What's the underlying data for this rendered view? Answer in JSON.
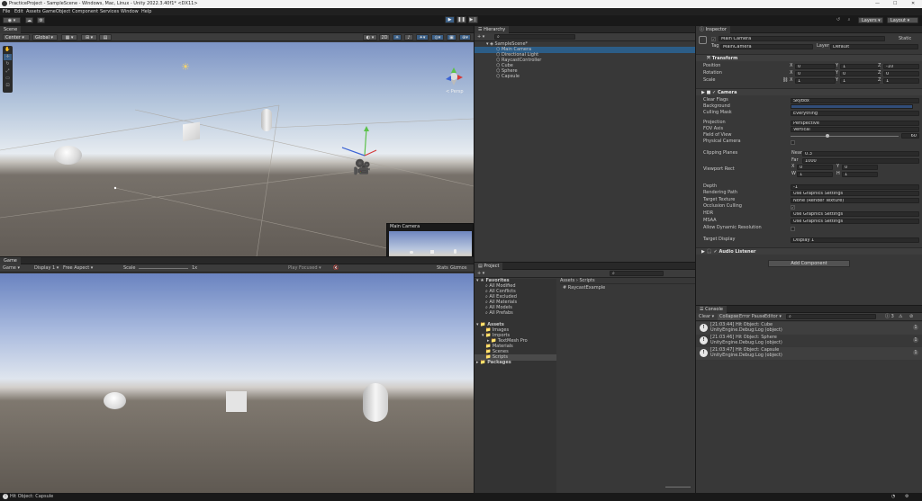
{
  "window": {
    "title": "PracticeProject - SampleScene - Windows, Mac, Linux - Unity 2022.3.40f1* <DX11>"
  },
  "menu": [
    "File",
    "Edit",
    "Assets",
    "GameObject",
    "Component",
    "Services",
    "Window",
    "Help"
  ],
  "toolbar": {
    "layers": "Layers",
    "layout": "Layout"
  },
  "scene": {
    "tab": "Scene",
    "center": "Center",
    "global": "Global",
    "persp": "< Persp",
    "preview_title": "Main Camera"
  },
  "game": {
    "tab": "Game",
    "mode": "Game",
    "display": "Display 1",
    "aspect": "Free Aspect",
    "scale_label": "Scale",
    "scale_value": "1x",
    "play_focused": "Play Focused",
    "stats": "Stats",
    "gizmos": "Gizmos"
  },
  "hierarchy": {
    "tab": "Hierarchy",
    "scene": "SampleScene*",
    "items": [
      "Main Camera",
      "Directional Light",
      "RaycastController",
      "Cube",
      "Sphere",
      "Capsule"
    ]
  },
  "project": {
    "tab": "Project",
    "favorites": "Favorites",
    "fav_items": [
      "All Modified",
      "All Conflicts",
      "All Excluded",
      "All Materials",
      "All Models",
      "All Prefabs"
    ],
    "assets": "Assets",
    "asset_items": [
      "Images",
      "Imports",
      "TextMesh Pro",
      "Materials",
      "Scenes",
      "Scripts"
    ],
    "packages": "Packages",
    "breadcrumb": [
      "Assets",
      "Scripts"
    ],
    "files": [
      "RaycastExample"
    ]
  },
  "inspector": {
    "tab": "Inspector",
    "object_name": "Main Camera",
    "static": "Static",
    "tag_label": "Tag",
    "tag": "MainCamera",
    "layer_label": "Layer",
    "layer": "Default",
    "transform": {
      "title": "Transform",
      "rows": [
        {
          "label": "Position",
          "x": "0",
          "y": "1",
          "z": "-10"
        },
        {
          "label": "Rotation",
          "x": "0",
          "y": "0",
          "z": "0"
        },
        {
          "label": "Scale",
          "x": "1",
          "y": "1",
          "z": "1"
        }
      ]
    },
    "camera": {
      "title": "Camera",
      "clear_flags_label": "Clear Flags",
      "clear_flags": "Skybox",
      "background_label": "Background",
      "culling_label": "Culling Mask",
      "culling": "Everything",
      "projection_label": "Projection",
      "projection": "Perspective",
      "fov_axis_label": "FOV Axis",
      "fov_axis": "Vertical",
      "fov_label": "Field of View",
      "fov": "60",
      "fov_fraction": 0.34,
      "physical_label": "Physical Camera",
      "clipping_label": "Clipping Planes",
      "near_label": "Near",
      "near": "0.3",
      "far_label": "Far",
      "far": "1000",
      "viewport_label": "Viewport Rect",
      "vx": "0",
      "vy": "0",
      "vw": "1",
      "vh": "1",
      "depth_label": "Depth",
      "depth": "-1",
      "rendering_label": "Rendering Path",
      "rendering": "Use Graphics Settings",
      "target_label": "Target Texture",
      "target": "None (Render Texture)",
      "occlusion_label": "Occlusion Culling",
      "hdr_label": "HDR",
      "hdr": "Use Graphics Settings",
      "msaa_label": "MSAA",
      "msaa": "Use Graphics Settings",
      "dynres_label": "Allow Dynamic Resolution",
      "display_label": "Target Display",
      "display": "Display 1"
    },
    "audio_listener": "Audio Listener",
    "add_component": "Add Component"
  },
  "console": {
    "tab": "Console",
    "clear": "Clear",
    "collapse": "Collapse",
    "error_pause": "Error Pause",
    "editor": "Editor",
    "entries": [
      {
        "line1": "[21:03:44] Hit Object: Cube",
        "line2": "UnityEngine.Debug:Log (object)",
        "count": "1"
      },
      {
        "line1": "[21:03:46] Hit Object: Sphere",
        "line2": "UnityEngine.Debug:Log (object)",
        "count": "1"
      },
      {
        "line1": "[21:03:47] Hit Object: Capsule",
        "line2": "UnityEngine.Debug:Log (object)",
        "count": "1"
      }
    ],
    "count_badge": "3"
  },
  "status": {
    "message": "Hit Object: Capsule"
  }
}
